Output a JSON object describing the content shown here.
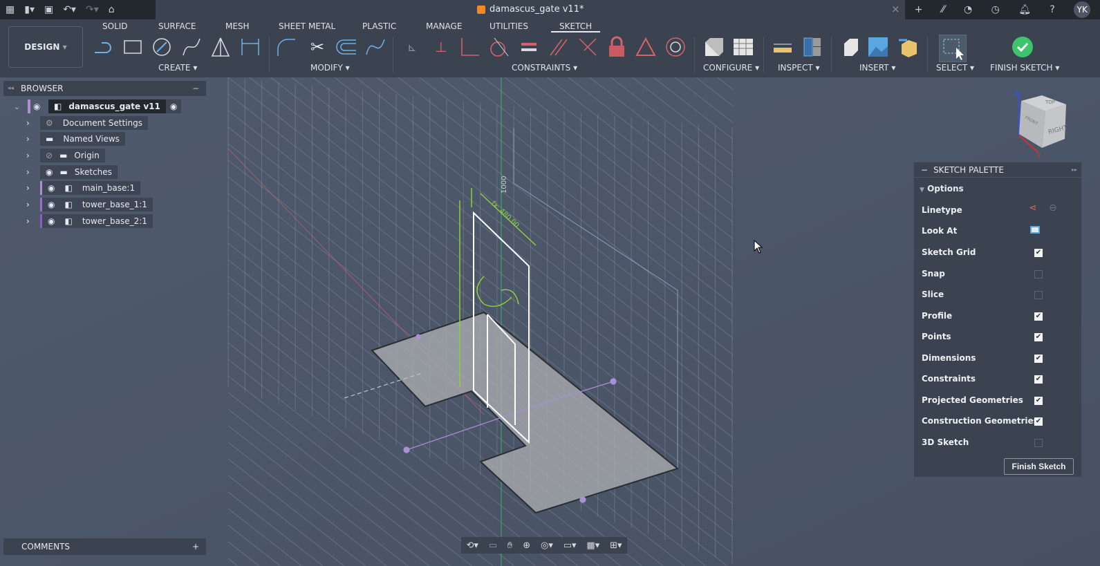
{
  "topbar": {
    "doc_title": "damascus_gate v11*",
    "user_initials": "YK",
    "icons": [
      "grid-icon",
      "file-icon",
      "save-icon",
      "undo-icon",
      "redo-icon",
      "home-icon"
    ],
    "right_icons": [
      "plus-icon",
      "extensions-icon",
      "online-icon",
      "job-status-icon",
      "notification-icon",
      "help-icon"
    ]
  },
  "toolbar": {
    "workspace": "DESIGN",
    "tabs": [
      "SOLID",
      "SURFACE",
      "MESH",
      "SHEET METAL",
      "PLASTIC",
      "MANAGE",
      "UTILITIES",
      "SKETCH"
    ],
    "active_tab": "SKETCH",
    "groups": {
      "create": "CREATE",
      "modify": "MODIFY",
      "constraints": "CONSTRAINTS",
      "configure": "CONFIGURE",
      "inspect": "INSPECT",
      "insert": "INSERT",
      "select": "SELECT",
      "finish": "FINISH SKETCH"
    }
  },
  "browser": {
    "title": "BROWSER",
    "root": "damascus_gate v11",
    "items": [
      "Document Settings",
      "Named Views",
      "Origin",
      "Sketches",
      "main_base:1",
      "tower_base_1:1",
      "tower_base_2:1"
    ]
  },
  "comments": {
    "title": "COMMENTS"
  },
  "viewcube": {
    "faces": [
      "TOP",
      "FRONT",
      "RIGHT"
    ],
    "axes": [
      "Z",
      "Y"
    ]
  },
  "dimensions": [
    "fx: 480.00",
    "1000"
  ],
  "palette": {
    "title": "SKETCH PALETTE",
    "section": "Options",
    "linetype": "Linetype",
    "look_at": "Look At",
    "options": [
      {
        "label": "Sketch Grid",
        "checked": true
      },
      {
        "label": "Snap",
        "checked": false
      },
      {
        "label": "Slice",
        "checked": false
      },
      {
        "label": "Profile",
        "checked": true
      },
      {
        "label": "Points",
        "checked": true
      },
      {
        "label": "Dimensions",
        "checked": true
      },
      {
        "label": "Constraints",
        "checked": true
      },
      {
        "label": "Projected Geometries",
        "checked": true
      },
      {
        "label": "Construction Geometries",
        "checked": true
      },
      {
        "label": "3D Sketch",
        "checked": false
      }
    ],
    "finish_button": "Finish Sketch"
  },
  "colors": {
    "accent_green": "#3ec46d",
    "sketch_green": "#8fce3e",
    "constraint_red": "#d9626a",
    "tool_blue": "#6fb2e6"
  }
}
